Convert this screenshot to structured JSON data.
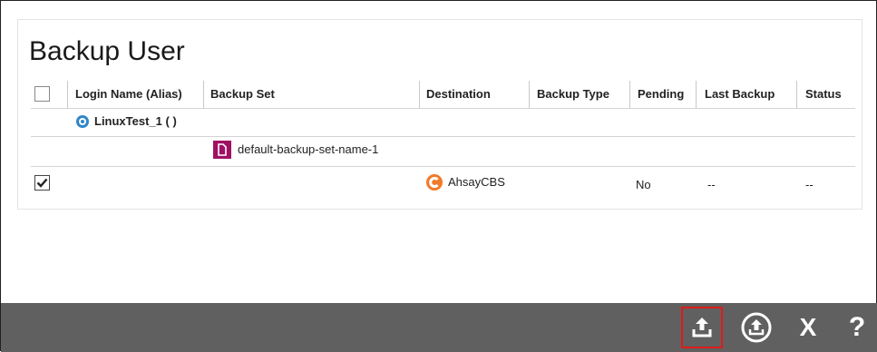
{
  "page": {
    "title": "Backup User"
  },
  "table": {
    "columns": [
      "Login Name (Alias)",
      "Backup Set",
      "Destination",
      "Backup Type",
      "Pending",
      "Last Backup",
      "Status"
    ],
    "user_row": {
      "login": "LinuxTest_1 ( )"
    },
    "set_row": {
      "backup_set": "default-backup-set-name-1"
    },
    "dest_row": {
      "checked": true,
      "destination": "AhsayCBS",
      "pending": "No",
      "last_backup": "--",
      "status": "--"
    }
  },
  "footer": {
    "buttons": [
      {
        "icon": "upload-icon",
        "selected": true
      },
      {
        "icon": "circle-upload-icon",
        "selected": false
      },
      {
        "icon": "close-icon",
        "label": "X"
      },
      {
        "icon": "help-icon",
        "label": "?"
      }
    ]
  },
  "colors": {
    "footer_bg": "#606060",
    "selected_outline": "#e01b1b",
    "user_icon": "#2f86c9",
    "backup_set_icon": "#a01063",
    "destination_icon": "#f07b2a"
  }
}
